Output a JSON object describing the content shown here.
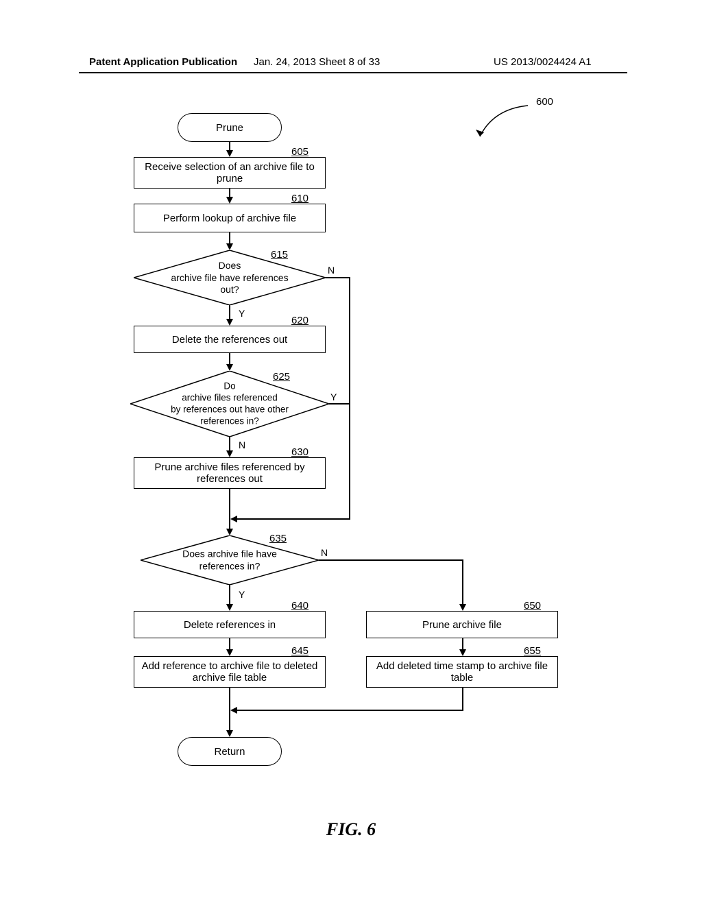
{
  "header": {
    "left": "Patent Application Publication",
    "center": "Jan. 24, 2013  Sheet 8 of 33",
    "right": "US 2013/0024424 A1"
  },
  "chart_data": {
    "type": "flowchart",
    "title": "FIG. 6",
    "overall_ref": "600",
    "nodes": [
      {
        "id": "start",
        "type": "terminal",
        "text": "Prune"
      },
      {
        "id": "605",
        "type": "process",
        "ref": "605",
        "text": "Receive selection of an archive file to prune"
      },
      {
        "id": "610",
        "type": "process",
        "ref": "610",
        "text": "Perform lookup of archive file"
      },
      {
        "id": "615",
        "type": "decision",
        "ref": "615",
        "text": "Does archive file have references out?"
      },
      {
        "id": "620",
        "type": "process",
        "ref": "620",
        "text": "Delete the references out"
      },
      {
        "id": "625",
        "type": "decision",
        "ref": "625",
        "text": "Do archive files referenced by references out have other references in?"
      },
      {
        "id": "630",
        "type": "process",
        "ref": "630",
        "text": "Prune archive files referenced by references out"
      },
      {
        "id": "635",
        "type": "decision",
        "ref": "635",
        "text": "Does archive file have references in?"
      },
      {
        "id": "640",
        "type": "process",
        "ref": "640",
        "text": "Delete references in"
      },
      {
        "id": "645",
        "type": "process",
        "ref": "645",
        "text": "Add reference to archive file to deleted archive file table"
      },
      {
        "id": "650",
        "type": "process",
        "ref": "650",
        "text": "Prune archive file"
      },
      {
        "id": "655",
        "type": "process",
        "ref": "655",
        "text": "Add deleted time stamp to archive file table"
      },
      {
        "id": "return",
        "type": "terminal",
        "text": "Return"
      }
    ],
    "edges": [
      {
        "from": "start",
        "to": "605"
      },
      {
        "from": "605",
        "to": "610"
      },
      {
        "from": "610",
        "to": "615"
      },
      {
        "from": "615",
        "to": "620",
        "label": "Y"
      },
      {
        "from": "615",
        "to": "635_merge",
        "label": "N"
      },
      {
        "from": "620",
        "to": "625"
      },
      {
        "from": "625",
        "to": "630",
        "label": "N"
      },
      {
        "from": "625",
        "to": "635_merge",
        "label": "Y"
      },
      {
        "from": "630",
        "to": "635_merge"
      },
      {
        "from": "635",
        "to": "640",
        "label": "Y"
      },
      {
        "from": "635",
        "to": "650",
        "label": "N"
      },
      {
        "from": "640",
        "to": "645"
      },
      {
        "from": "650",
        "to": "655"
      },
      {
        "from": "645",
        "to": "return_merge"
      },
      {
        "from": "655",
        "to": "return_merge"
      },
      {
        "from": "return_merge",
        "to": "return"
      }
    ]
  },
  "flow": {
    "start": "Prune",
    "n605": "Receive selection of an archive file to prune",
    "n610": "Perform lookup of archive file",
    "n615_l1": "Does",
    "n615_l2": "archive file have references",
    "n615_l3": "out?",
    "n620": "Delete the references out",
    "n625_l1": "Do",
    "n625_l2": "archive files referenced",
    "n625_l3": "by references out have other",
    "n625_l4": "references in?",
    "n630": "Prune archive files referenced by references out",
    "n635_l1": "Does archive file have",
    "n635_l2": "references in?",
    "n640": "Delete references in",
    "n645": "Add reference to archive file to deleted archive file table",
    "n650": "Prune archive file",
    "n655": "Add deleted time stamp to archive file table",
    "ret": "Return"
  },
  "refs": {
    "r600": "600",
    "r605": "605",
    "r610": "610",
    "r615": "615",
    "r620": "620",
    "r625": "625",
    "r630": "630",
    "r635": "635",
    "r640": "640",
    "r645": "645",
    "r650": "650",
    "r655": "655"
  },
  "labels": {
    "Y": "Y",
    "N": "N"
  },
  "caption": "FIG. 6"
}
